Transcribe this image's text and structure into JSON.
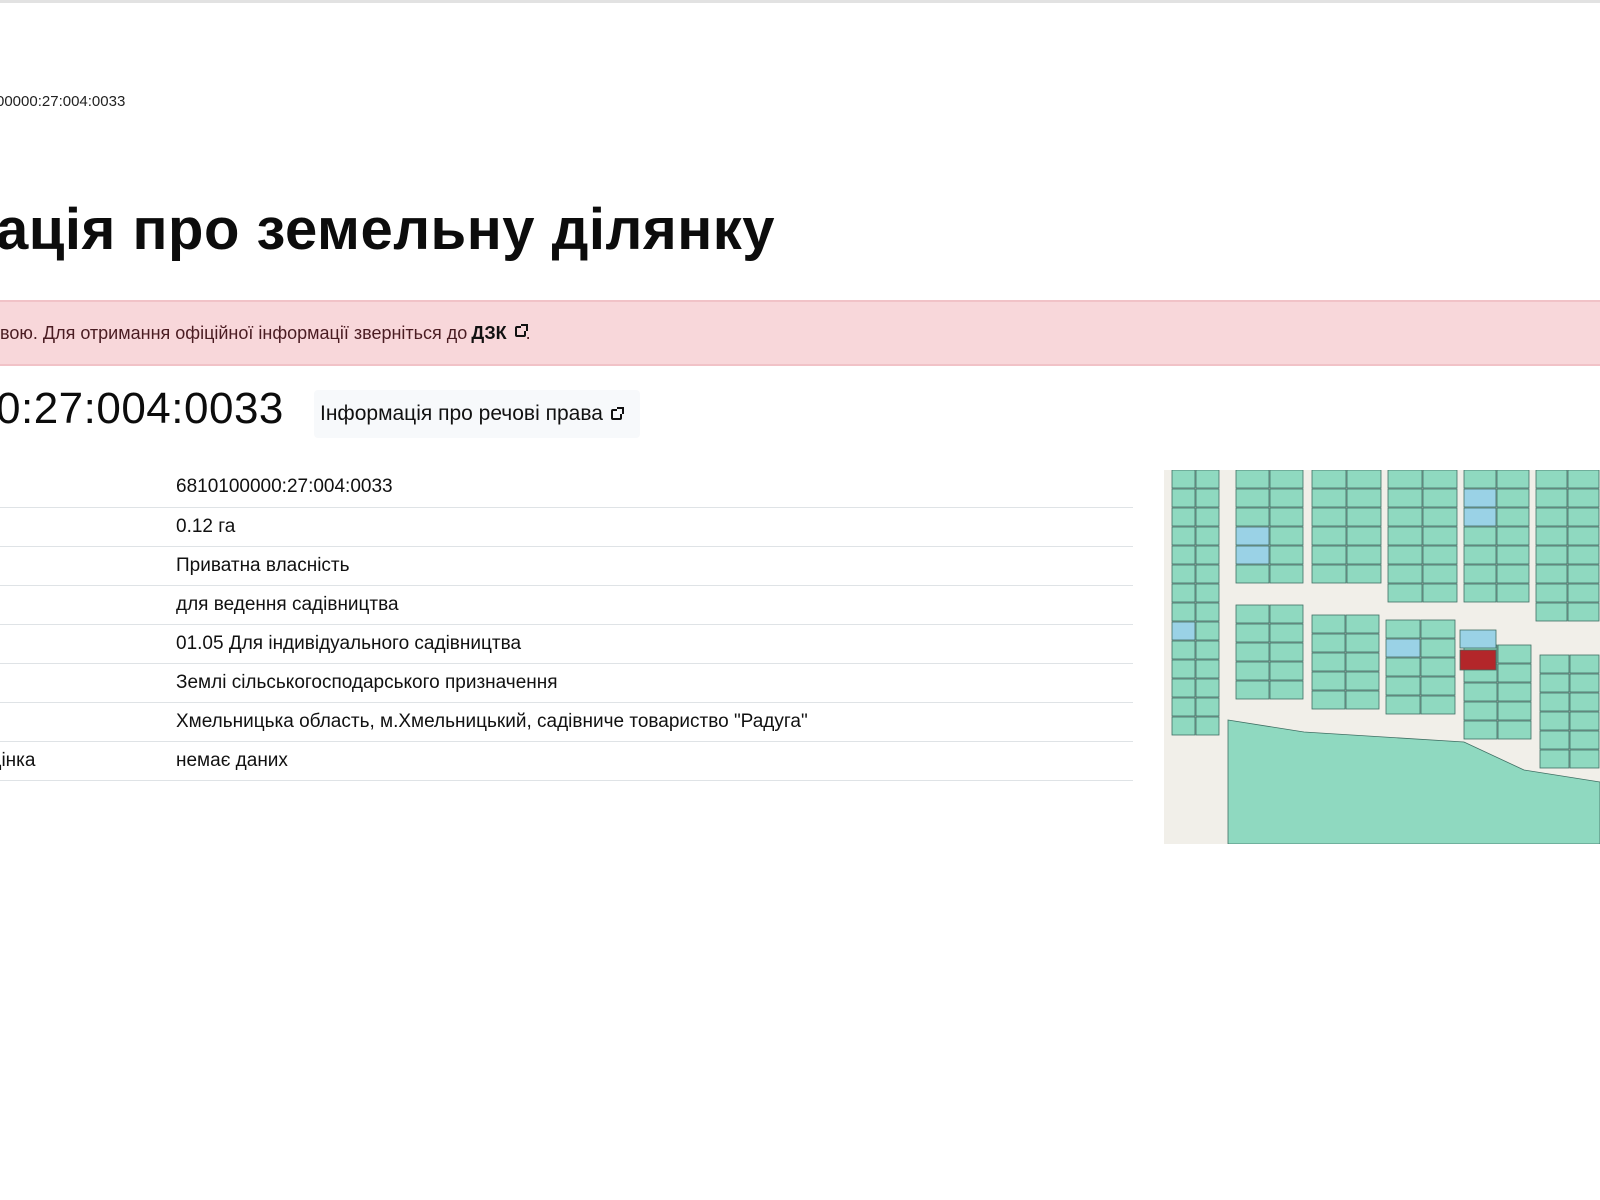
{
  "breadcrumb": "00000:27:004:0033",
  "page_title": "ація про земельну ділянку",
  "alert": {
    "text": "вою. Для отримання офіційної інформації зверніться до",
    "link_label": "ДЗК",
    "suffix": "."
  },
  "cadastral_number_heading": "0:27:004:0033",
  "rights_button_label": "Інформація про речові права",
  "table": {
    "rows": [
      {
        "label": "",
        "value": "6810100000:27:004:0033"
      },
      {
        "label": "",
        "value": "0.12 га"
      },
      {
        "label": "",
        "value": "Приватна власність"
      },
      {
        "label": "",
        "value": "для ведення садівництва"
      },
      {
        "label": "",
        "value": "01.05 Для індивідуального садівництва"
      },
      {
        "label": "",
        "value": "Землі сільськогосподарського призначення"
      },
      {
        "label": "",
        "value": "Хмельницька область, м.Хмельницький, садівниче товариство \"Радуга\""
      },
      {
        "label": "оцінка",
        "value": "немає даних"
      }
    ]
  },
  "map": {
    "colors": {
      "parcel": "#8fd9c0",
      "parcel_alt": "#9ad2e6",
      "selected": "#b3262a",
      "background": "#f1efe9",
      "outline": "#3f6f63"
    }
  }
}
